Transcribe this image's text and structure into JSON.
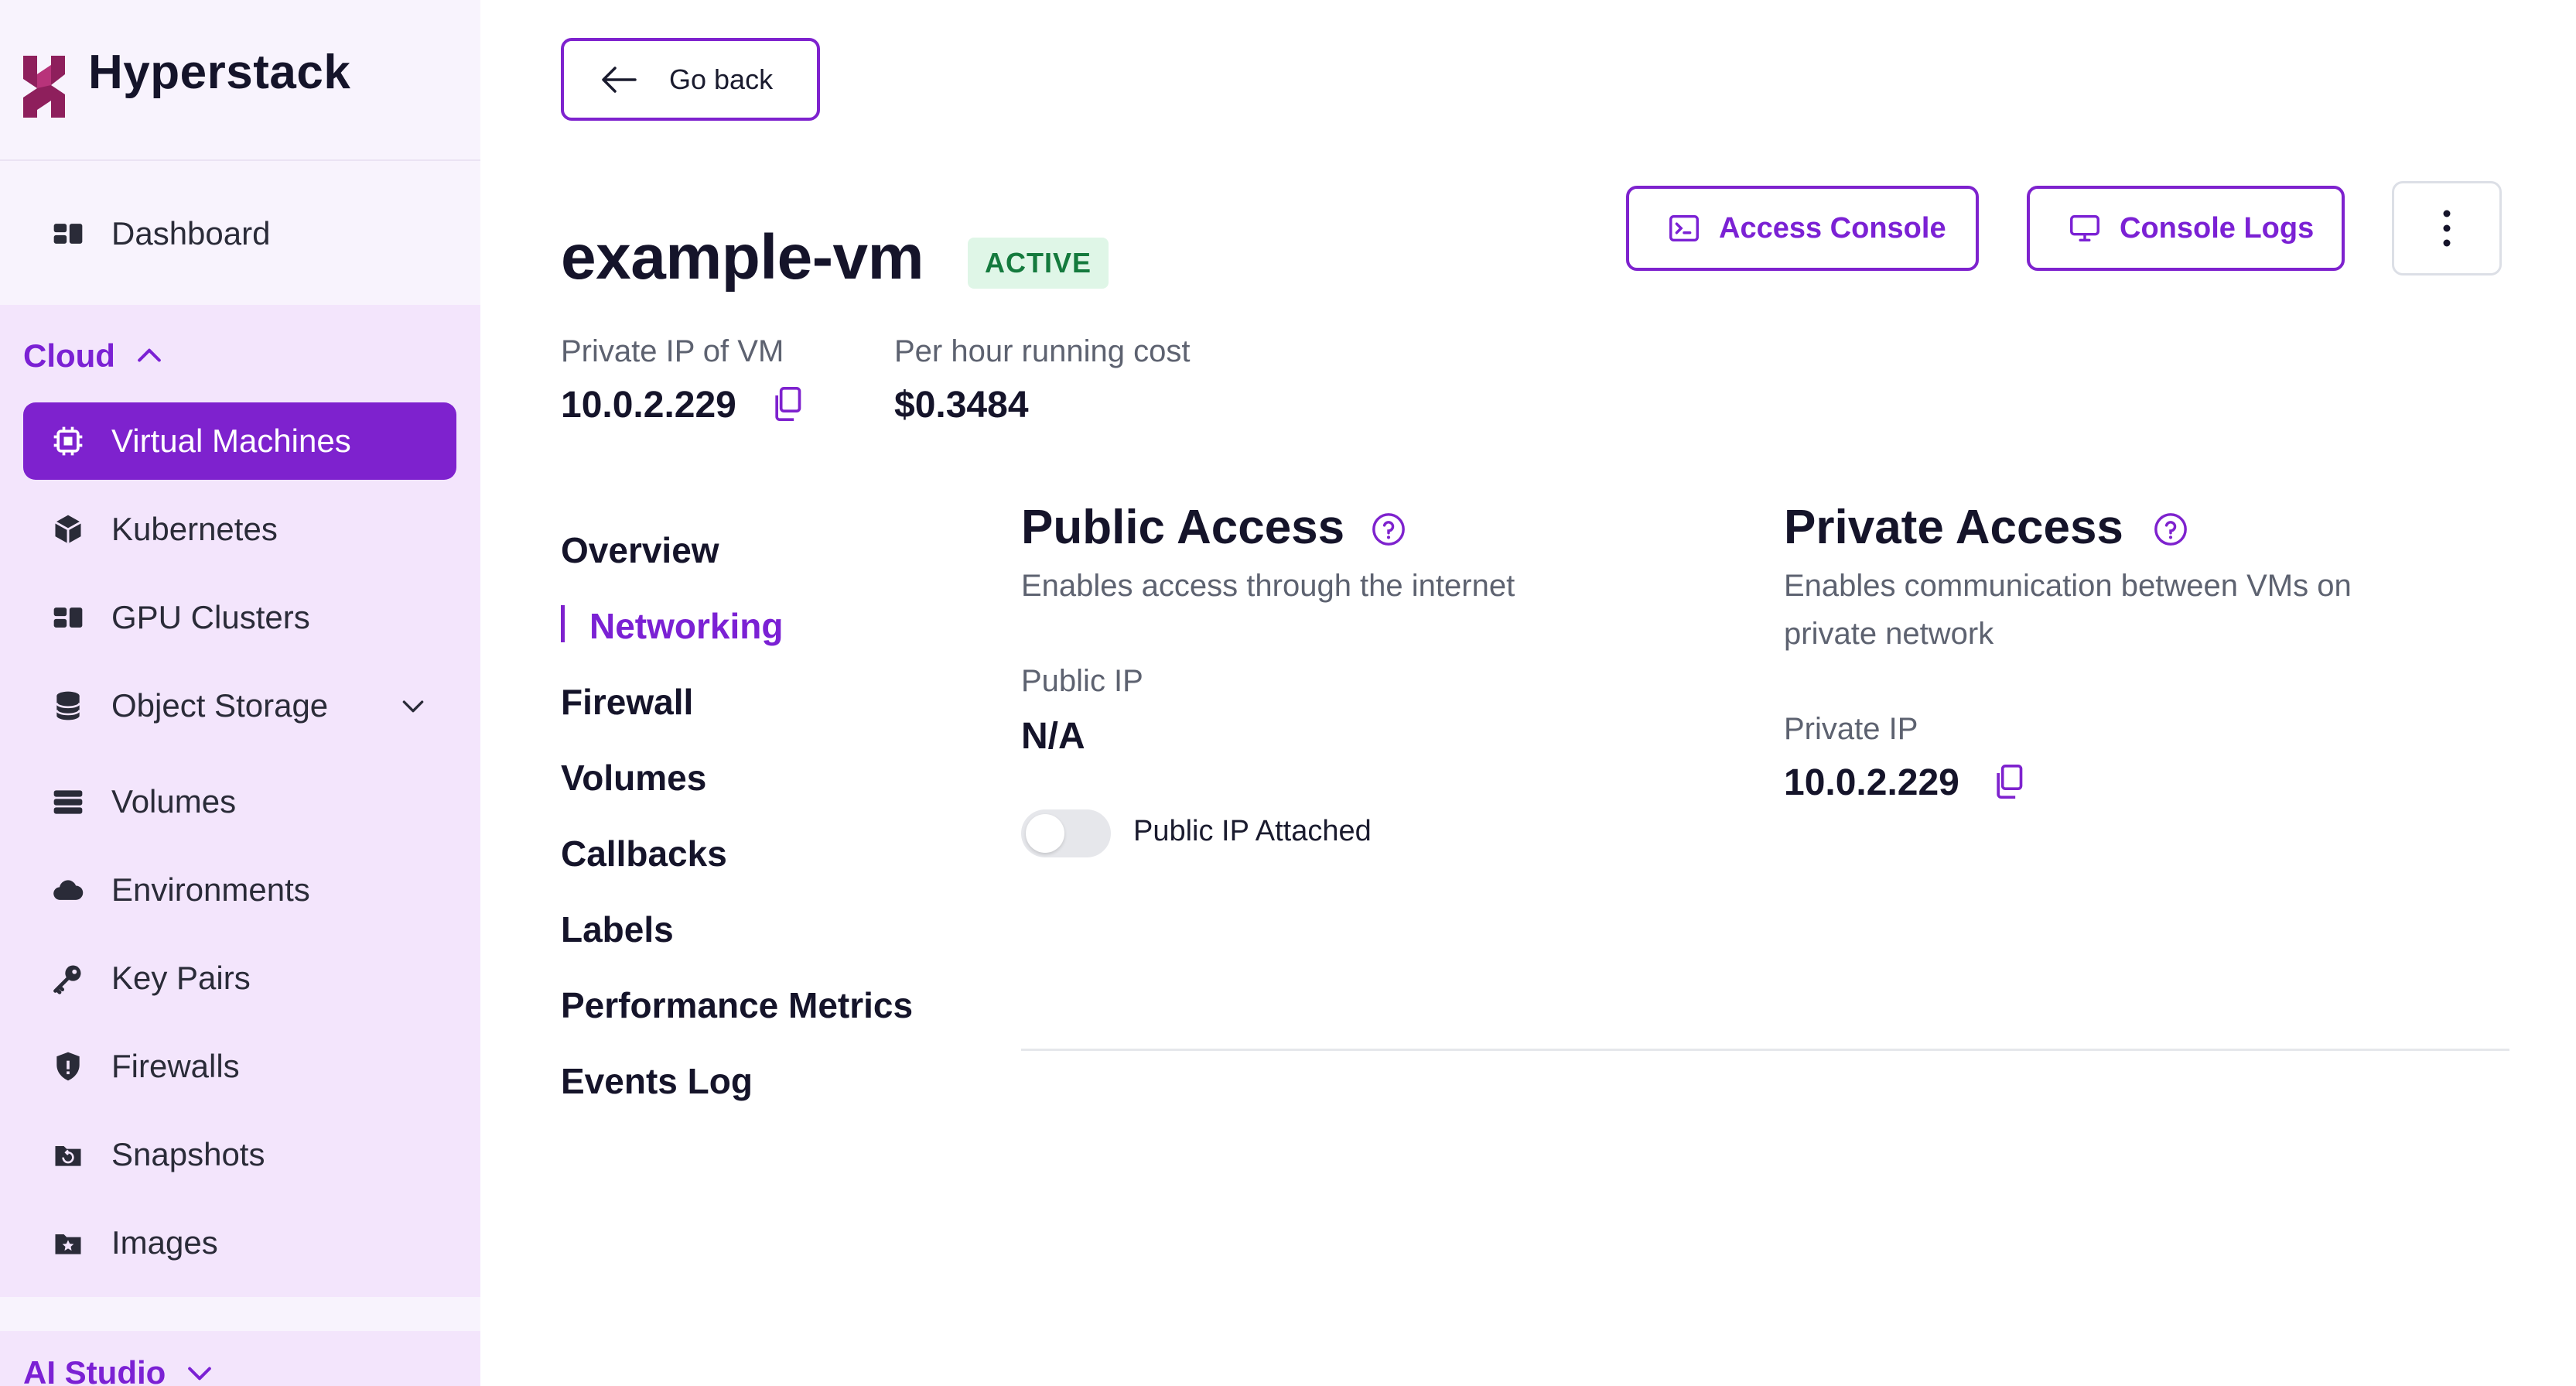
{
  "brand": {
    "name": "Hyperstack"
  },
  "sidebar": {
    "dashboard": {
      "label": "Dashboard",
      "icon": "dashboard-icon"
    },
    "cloud": {
      "title": "Cloud",
      "items": [
        {
          "label": "Virtual Machines",
          "icon": "chip-icon",
          "active": true
        },
        {
          "label": "Kubernetes",
          "icon": "cube-icon"
        },
        {
          "label": "GPU Clusters",
          "icon": "clusters-icon"
        },
        {
          "label": "Object Storage",
          "icon": "database-icon",
          "expandable": true
        },
        {
          "label": "Volumes",
          "icon": "volumes-icon"
        },
        {
          "label": "Environments",
          "icon": "cloud-icon"
        },
        {
          "label": "Key Pairs",
          "icon": "key-icon"
        },
        {
          "label": "Firewalls",
          "icon": "shield-icon"
        },
        {
          "label": "Snapshots",
          "icon": "snapshot-icon"
        },
        {
          "label": "Images",
          "icon": "image-icon"
        }
      ]
    },
    "ai_studio": {
      "title": "AI Studio"
    }
  },
  "header": {
    "go_back": "Go back",
    "vm_name": "example-vm",
    "status": "ACTIVE",
    "access_console": "Access Console",
    "console_logs": "Console Logs"
  },
  "meta": {
    "private_ip_label": "Private IP of VM",
    "private_ip": "10.0.2.229",
    "cost_label": "Per hour running cost",
    "cost": "$0.3484"
  },
  "tabs": [
    {
      "label": "Overview"
    },
    {
      "label": "Networking",
      "active": true
    },
    {
      "label": "Firewall"
    },
    {
      "label": "Volumes"
    },
    {
      "label": "Callbacks"
    },
    {
      "label": "Labels"
    },
    {
      "label": "Performance Metrics"
    },
    {
      "label": "Events Log"
    }
  ],
  "networking": {
    "public": {
      "title": "Public Access",
      "description": "Enables access through the internet",
      "ip_label": "Public IP",
      "ip_value": "N/A",
      "toggle_label": "Public IP Attached",
      "toggle_on": false
    },
    "private": {
      "title": "Private Access",
      "description_line1": "Enables communication between VMs on",
      "description_line2": "private network",
      "ip_label": "Private IP",
      "ip_value": "10.0.2.229"
    }
  },
  "colors": {
    "accent": "#7e22ce",
    "sidebar_bg": "#f8f3fd",
    "cloud_section_bg": "#f3e5fc",
    "status_bg": "#dff6e7",
    "status_text": "#147a3d"
  }
}
